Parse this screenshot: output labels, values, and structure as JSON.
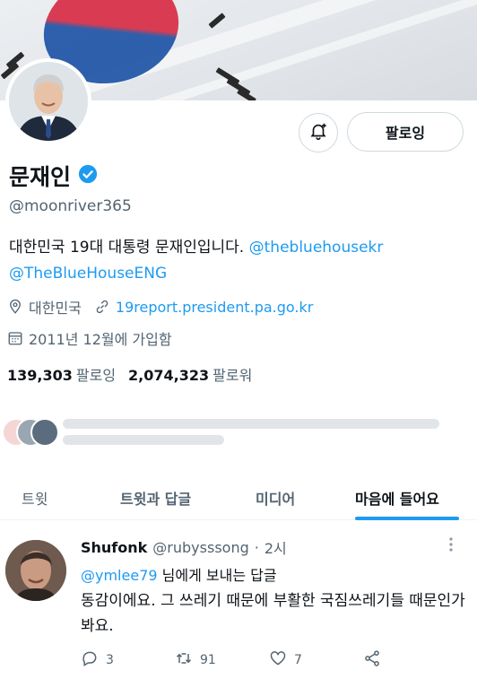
{
  "profile": {
    "name": "문재인",
    "handle": "@moonriver365",
    "bio_text": "대한민국 19대 대통령 문재인입니다. ",
    "bio_mention1": "@thebluehousekr",
    "bio_mention2": "@TheBlueHouseENG",
    "location": "대한민국",
    "website": "19report.president.pa.go.kr",
    "joined": "2011년 12월에 가입함",
    "following_count": "139,303",
    "following_label": "팔로잉",
    "followers_count": "2,074,323",
    "followers_label": "팔로워",
    "follow_button": "팔로잉"
  },
  "tabs": [
    {
      "label": "트윗"
    },
    {
      "label": "트윗과 답글"
    },
    {
      "label": "미디어"
    },
    {
      "label": "마음에 들어요"
    }
  ],
  "tweet": {
    "display_name": "Shufonk",
    "handle": "@rubysssong",
    "separator": "·",
    "time": "2시",
    "reply_mention": "@ymlee79",
    "reply_suffix": " 님에게 보내는 답글",
    "body": "동감이에요. 그 쓰레기 때문에 부활한 국짐쓰레기들 때문인가봐요.",
    "replies": "3",
    "retweets": "91",
    "likes": "7"
  },
  "colors": {
    "accent": "#1d9bf0",
    "verified": "#1d9bf0",
    "secondary_text": "#536471"
  }
}
